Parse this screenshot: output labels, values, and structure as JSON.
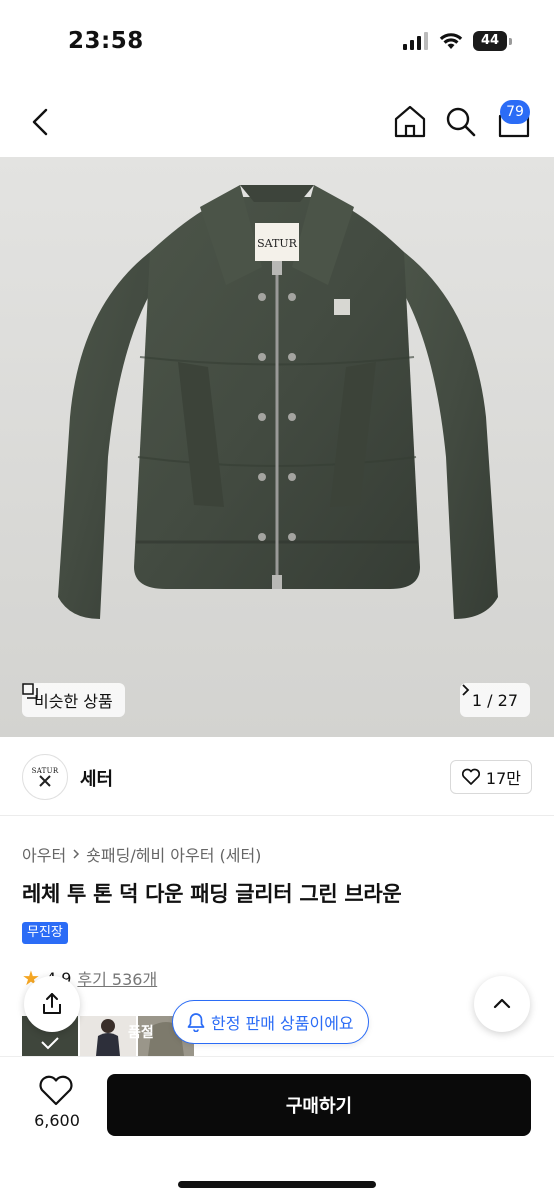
{
  "status_bar": {
    "time": "23:58",
    "battery": "44"
  },
  "nav": {
    "cart_count": "79"
  },
  "hero": {
    "jacket_label": "SATUR",
    "similar_label": "비슷한 상품",
    "page_indicator": "1 / 27"
  },
  "brand": {
    "logo_text": "SATUR",
    "name": "세터",
    "like_count": "17만"
  },
  "product": {
    "breadcrumb": [
      "아우터",
      "숏패딩/헤비 아우터 (세터)"
    ],
    "title": "레체 투 톤 덕 다운 패딩 글리터 그린 브라운",
    "badge": "무진장",
    "rating": "4.9",
    "reviews": "후기 536개"
  },
  "thumbnails": {
    "soldout_label": "품절"
  },
  "floating": {
    "limited_label": "한정 판매 상품이에요"
  },
  "bottom_bar": {
    "wish_count": "6,600",
    "buy_label": "구매하기"
  },
  "colors": {
    "accent": "#2b6cf6",
    "jacket": "#444c42",
    "buy": "#0a0a0a"
  }
}
